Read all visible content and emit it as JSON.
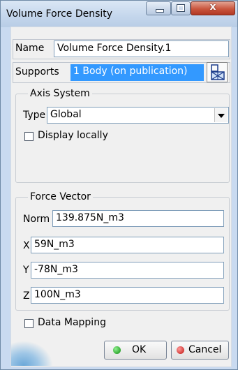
{
  "window": {
    "title": "Volume Force Density"
  },
  "titlebar": {
    "close_glyph": "x"
  },
  "name": {
    "label": "Name",
    "value": "Volume Force Density.1"
  },
  "supports": {
    "label": "Supports",
    "value": "1 Body (on publication)",
    "icon": "geometry-select-icon"
  },
  "axis_system": {
    "legend": "Axis System",
    "type_label": "Type",
    "type_value": "Global",
    "display_locally_label": "Display locally",
    "display_locally_checked": false
  },
  "force_vector": {
    "legend": "Force Vector",
    "norm_label": "Norm",
    "norm_value": "139.875N_m3",
    "x_label": "X",
    "x_value": "59N_m3",
    "y_label": "Y",
    "y_value": "-78N_m3",
    "z_label": "Z",
    "z_value": "100N_m3"
  },
  "data_mapping": {
    "label": "Data Mapping",
    "checked": false
  },
  "buttons": {
    "ok": "OK",
    "cancel": "Cancel"
  },
  "colors": {
    "selection": "#3399ff",
    "ok_dot": "#0a8a0a",
    "cancel_dot": "#c0120d"
  }
}
